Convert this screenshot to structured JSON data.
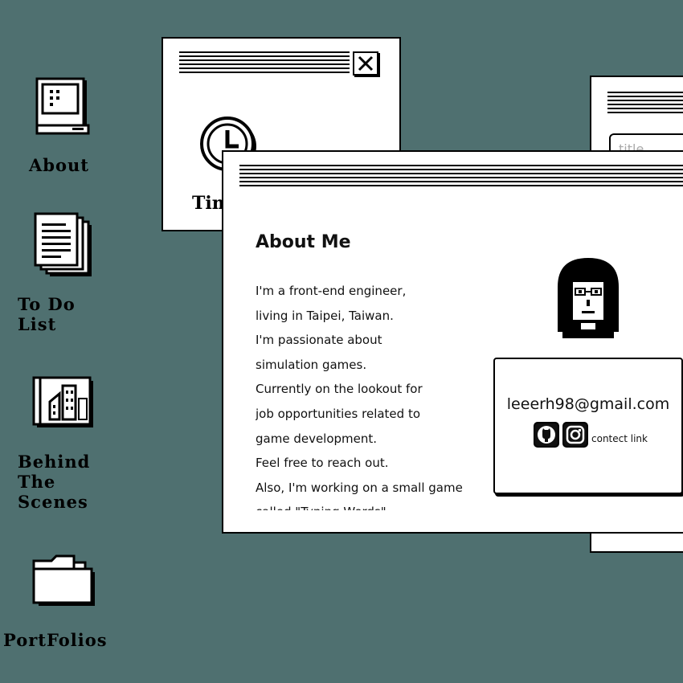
{
  "desktop": {
    "icons": [
      {
        "label": "About"
      },
      {
        "label": "To Do\nList"
      },
      {
        "label": "Behind\nThe\nScenes"
      },
      {
        "label": "PortFolios"
      }
    ]
  },
  "timer_window": {
    "label": "Timer"
  },
  "todo_window": {
    "input_placeholder": "title"
  },
  "about_window": {
    "heading": "About Me",
    "lines": [
      "I'm a front-end engineer,",
      "living in Taipei, Taiwan.",
      "I'm passionate about",
      "simulation games.",
      "Currently on the lookout for",
      "job opportunities related to",
      "game development.",
      "Feel free to reach out.",
      "Also, I'm working on a small game",
      "called \"Typing Words\""
    ],
    "email": "leeerh98@gmail.com",
    "contact_link": "contect link",
    "icons": {
      "github": "github-icon",
      "instagram": "instagram-icon"
    }
  },
  "colors": {
    "desktop": "#4f7070",
    "window": "#ffffff",
    "ink": "#000000"
  }
}
